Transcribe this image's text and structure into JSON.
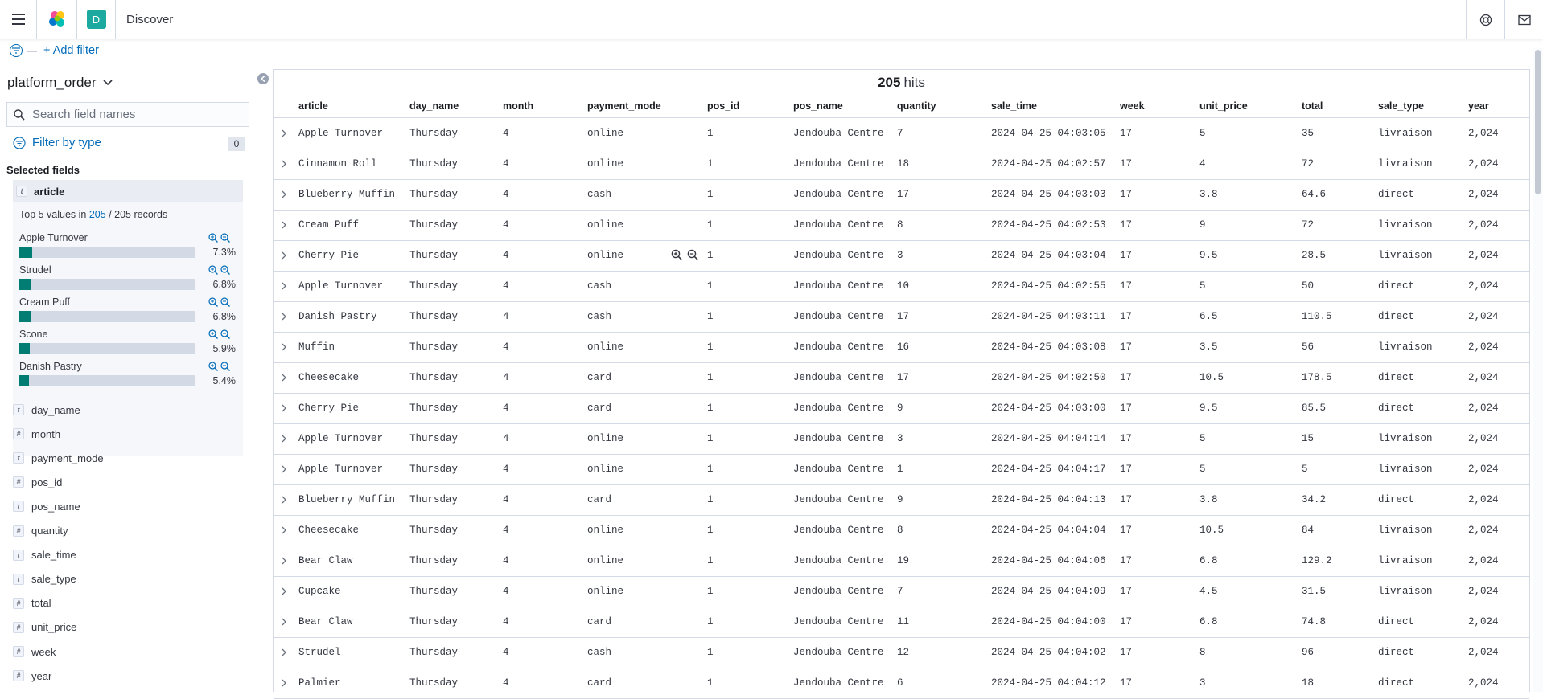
{
  "header": {
    "breadcrumb": "Discover",
    "space_initial": "D"
  },
  "filter_bar": {
    "add_filter": "+ Add filter"
  },
  "sidebar": {
    "index_pattern": "platform_order",
    "search_placeholder": "Search field names",
    "filter_by_type": "Filter by type",
    "filter_count": "0",
    "selected_fields_title": "Selected fields",
    "selected_field": {
      "name": "article",
      "type": "t"
    },
    "top_values": {
      "prefix": "Top 5 values in ",
      "count": "205",
      "separator": " / ",
      "suffix": "205 records",
      "values": [
        {
          "name": "Apple Turnover",
          "pct_label": "7.3%",
          "pct": 7.3
        },
        {
          "name": "Strudel",
          "pct_label": "6.8%",
          "pct": 6.8
        },
        {
          "name": "Cream Puff",
          "pct_label": "6.8%",
          "pct": 6.8
        },
        {
          "name": "Scone",
          "pct_label": "5.9%",
          "pct": 5.9
        },
        {
          "name": "Danish Pastry",
          "pct_label": "5.4%",
          "pct": 5.4
        }
      ]
    },
    "fields": [
      {
        "type": "t",
        "name": "day_name"
      },
      {
        "type": "#",
        "name": "month"
      },
      {
        "type": "t",
        "name": "payment_mode"
      },
      {
        "type": "#",
        "name": "pos_id"
      },
      {
        "type": "t",
        "name": "pos_name"
      },
      {
        "type": "#",
        "name": "quantity"
      },
      {
        "type": "t",
        "name": "sale_time"
      },
      {
        "type": "t",
        "name": "sale_type"
      },
      {
        "type": "#",
        "name": "total"
      },
      {
        "type": "#",
        "name": "unit_price"
      },
      {
        "type": "#",
        "name": "week"
      },
      {
        "type": "#",
        "name": "year"
      }
    ]
  },
  "results": {
    "hits_count": "205",
    "hits_label": "hits",
    "columns": [
      "article",
      "day_name",
      "month",
      "payment_mode",
      "pos_id",
      "pos_name",
      "quantity",
      "sale_time",
      "week",
      "unit_price",
      "total",
      "sale_type",
      "year"
    ],
    "rows": [
      [
        "Apple Turnover",
        "Thursday",
        "4",
        "online",
        "1",
        "Jendouba Centre",
        "7",
        "2024-04-25 04:03:05",
        "17",
        "5",
        "35",
        "livraison",
        "2,024"
      ],
      [
        "Cinnamon Roll",
        "Thursday",
        "4",
        "online",
        "1",
        "Jendouba Centre",
        "18",
        "2024-04-25 04:02:57",
        "17",
        "4",
        "72",
        "livraison",
        "2,024"
      ],
      [
        "Blueberry Muffin",
        "Thursday",
        "4",
        "cash",
        "1",
        "Jendouba Centre",
        "17",
        "2024-04-25 04:03:03",
        "17",
        "3.8",
        "64.6",
        "direct",
        "2,024"
      ],
      [
        "Cream Puff",
        "Thursday",
        "4",
        "online",
        "1",
        "Jendouba Centre",
        "8",
        "2024-04-25 04:02:53",
        "17",
        "9",
        "72",
        "livraison",
        "2,024"
      ],
      [
        "Cherry Pie",
        "Thursday",
        "4",
        "online",
        "1",
        "Jendouba Centre",
        "3",
        "2024-04-25 04:03:04",
        "17",
        "9.5",
        "28.5",
        "livraison",
        "2,024"
      ],
      [
        "Apple Turnover",
        "Thursday",
        "4",
        "cash",
        "1",
        "Jendouba Centre",
        "10",
        "2024-04-25 04:02:55",
        "17",
        "5",
        "50",
        "direct",
        "2,024"
      ],
      [
        "Danish Pastry",
        "Thursday",
        "4",
        "cash",
        "1",
        "Jendouba Centre",
        "17",
        "2024-04-25 04:03:11",
        "17",
        "6.5",
        "110.5",
        "direct",
        "2,024"
      ],
      [
        "Muffin",
        "Thursday",
        "4",
        "online",
        "1",
        "Jendouba Centre",
        "16",
        "2024-04-25 04:03:08",
        "17",
        "3.5",
        "56",
        "livraison",
        "2,024"
      ],
      [
        "Cheesecake",
        "Thursday",
        "4",
        "card",
        "1",
        "Jendouba Centre",
        "17",
        "2024-04-25 04:02:50",
        "17",
        "10.5",
        "178.5",
        "direct",
        "2,024"
      ],
      [
        "Cherry Pie",
        "Thursday",
        "4",
        "card",
        "1",
        "Jendouba Centre",
        "9",
        "2024-04-25 04:03:00",
        "17",
        "9.5",
        "85.5",
        "direct",
        "2,024"
      ],
      [
        "Apple Turnover",
        "Thursday",
        "4",
        "online",
        "1",
        "Jendouba Centre",
        "3",
        "2024-04-25 04:04:14",
        "17",
        "5",
        "15",
        "livraison",
        "2,024"
      ],
      [
        "Apple Turnover",
        "Thursday",
        "4",
        "online",
        "1",
        "Jendouba Centre",
        "1",
        "2024-04-25 04:04:17",
        "17",
        "5",
        "5",
        "livraison",
        "2,024"
      ],
      [
        "Blueberry Muffin",
        "Thursday",
        "4",
        "card",
        "1",
        "Jendouba Centre",
        "9",
        "2024-04-25 04:04:13",
        "17",
        "3.8",
        "34.2",
        "direct",
        "2,024"
      ],
      [
        "Cheesecake",
        "Thursday",
        "4",
        "online",
        "1",
        "Jendouba Centre",
        "8",
        "2024-04-25 04:04:04",
        "17",
        "10.5",
        "84",
        "livraison",
        "2,024"
      ],
      [
        "Bear Claw",
        "Thursday",
        "4",
        "online",
        "1",
        "Jendouba Centre",
        "19",
        "2024-04-25 04:04:06",
        "17",
        "6.8",
        "129.2",
        "livraison",
        "2,024"
      ],
      [
        "Cupcake",
        "Thursday",
        "4",
        "online",
        "1",
        "Jendouba Centre",
        "7",
        "2024-04-25 04:04:09",
        "17",
        "4.5",
        "31.5",
        "livraison",
        "2,024"
      ],
      [
        "Bear Claw",
        "Thursday",
        "4",
        "card",
        "1",
        "Jendouba Centre",
        "11",
        "2024-04-25 04:04:00",
        "17",
        "6.8",
        "74.8",
        "direct",
        "2,024"
      ],
      [
        "Strudel",
        "Thursday",
        "4",
        "cash",
        "1",
        "Jendouba Centre",
        "12",
        "2024-04-25 04:04:02",
        "17",
        "8",
        "96",
        "direct",
        "2,024"
      ],
      [
        "Palmier",
        "Thursday",
        "4",
        "card",
        "1",
        "Jendouba Centre",
        "6",
        "2024-04-25 04:04:12",
        "17",
        "3",
        "18",
        "direct",
        "2,024"
      ]
    ]
  }
}
